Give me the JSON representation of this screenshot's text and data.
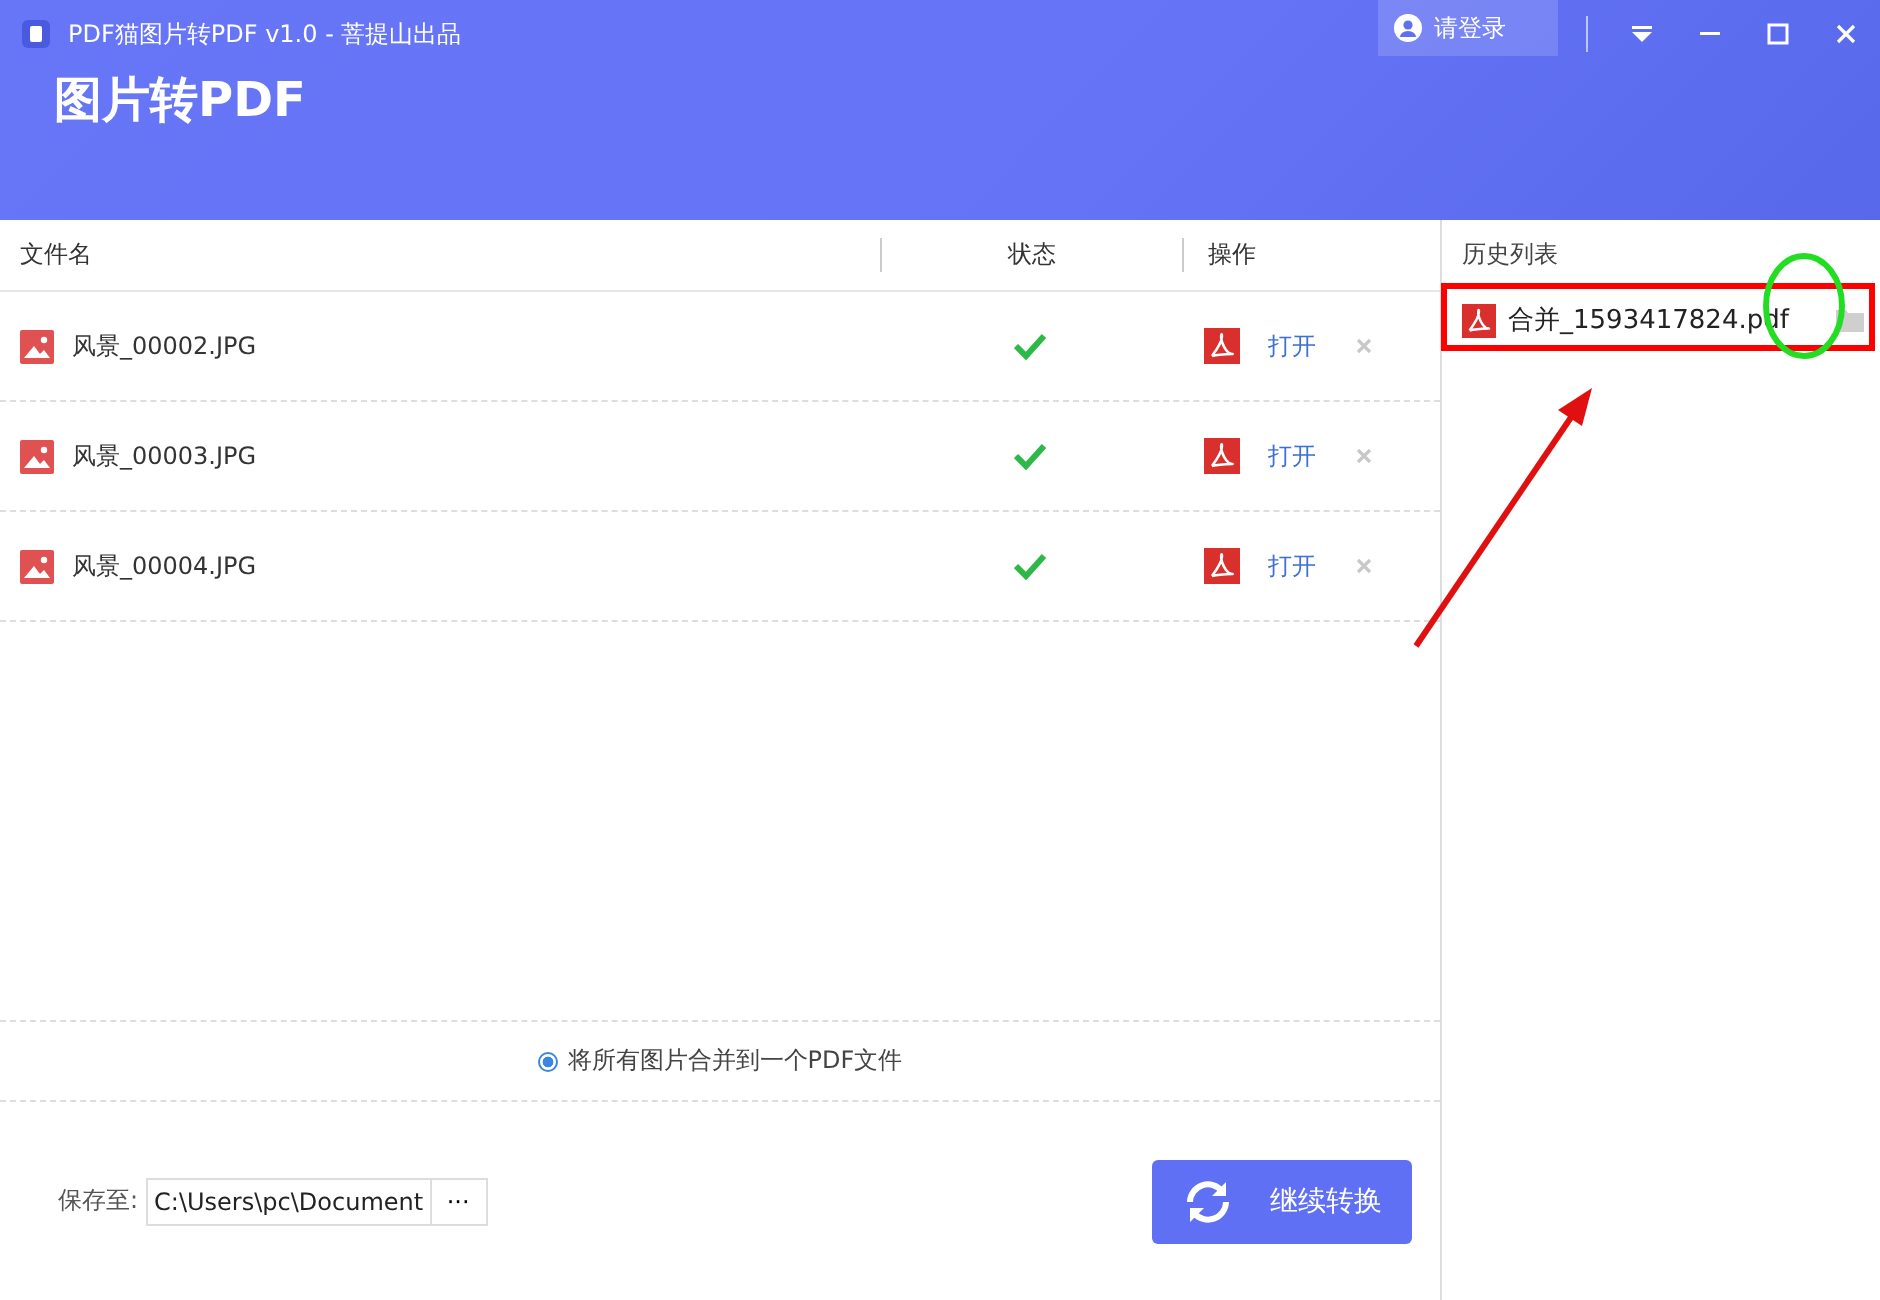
{
  "window": {
    "title": "PDF猫图片转PDF v1.0 - 菩提山出品",
    "login": "请登录"
  },
  "heading": "图片转PDF",
  "table": {
    "columns": [
      "文件名",
      "状态",
      "操作"
    ],
    "rows": [
      {
        "name": "风景_00002.JPG",
        "done": true,
        "action": "打开"
      },
      {
        "name": "风景_00003.JPG",
        "done": true,
        "action": "打开"
      },
      {
        "name": "风景_00004.JPG",
        "done": true,
        "action": "打开"
      }
    ]
  },
  "merge_option": {
    "label": "将所有图片合并到一个PDF文件",
    "selected": true
  },
  "save": {
    "label": "保存至:",
    "value": "C:\\Users\\pc\\Document",
    "browse": "···"
  },
  "convert_button": "继续转换",
  "history": {
    "title": "历史列表",
    "items": [
      {
        "name": "合并_1593417824.pdf"
      }
    ]
  }
}
